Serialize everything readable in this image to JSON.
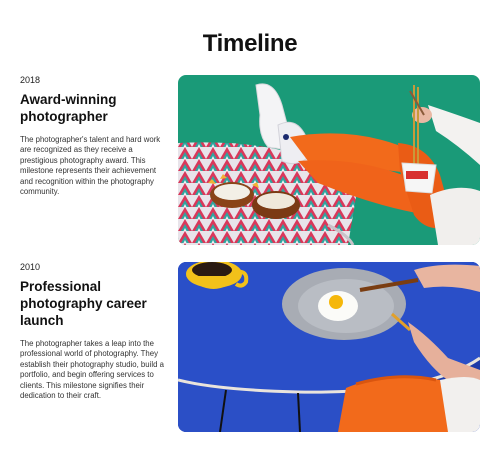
{
  "page": {
    "title": "Timeline"
  },
  "entries": [
    {
      "year": "2018",
      "title": "Award-winning photographer",
      "description": "The photographer's talent and hard work are recognized as they receive a prestigious photography award. This milestone represents their achievement and recognition within the photography community.",
      "image": "photo-legs-on-table-with-food-bowls"
    },
    {
      "year": "2010",
      "title": "Professional photography career launch",
      "description": "The photographer takes a leap into the professional world of photography. They establish their photography studio, build a portfolio, and begin offering services to clients. This milestone signifies their dedication to their craft.",
      "image": "photo-blue-table-fried-egg-and-coffee"
    }
  ],
  "colors": {
    "green_bg": "#1a9a78",
    "blue_table": "#2a4fc8",
    "orange": "#f26a1b",
    "yellow": "#f2c11a"
  }
}
